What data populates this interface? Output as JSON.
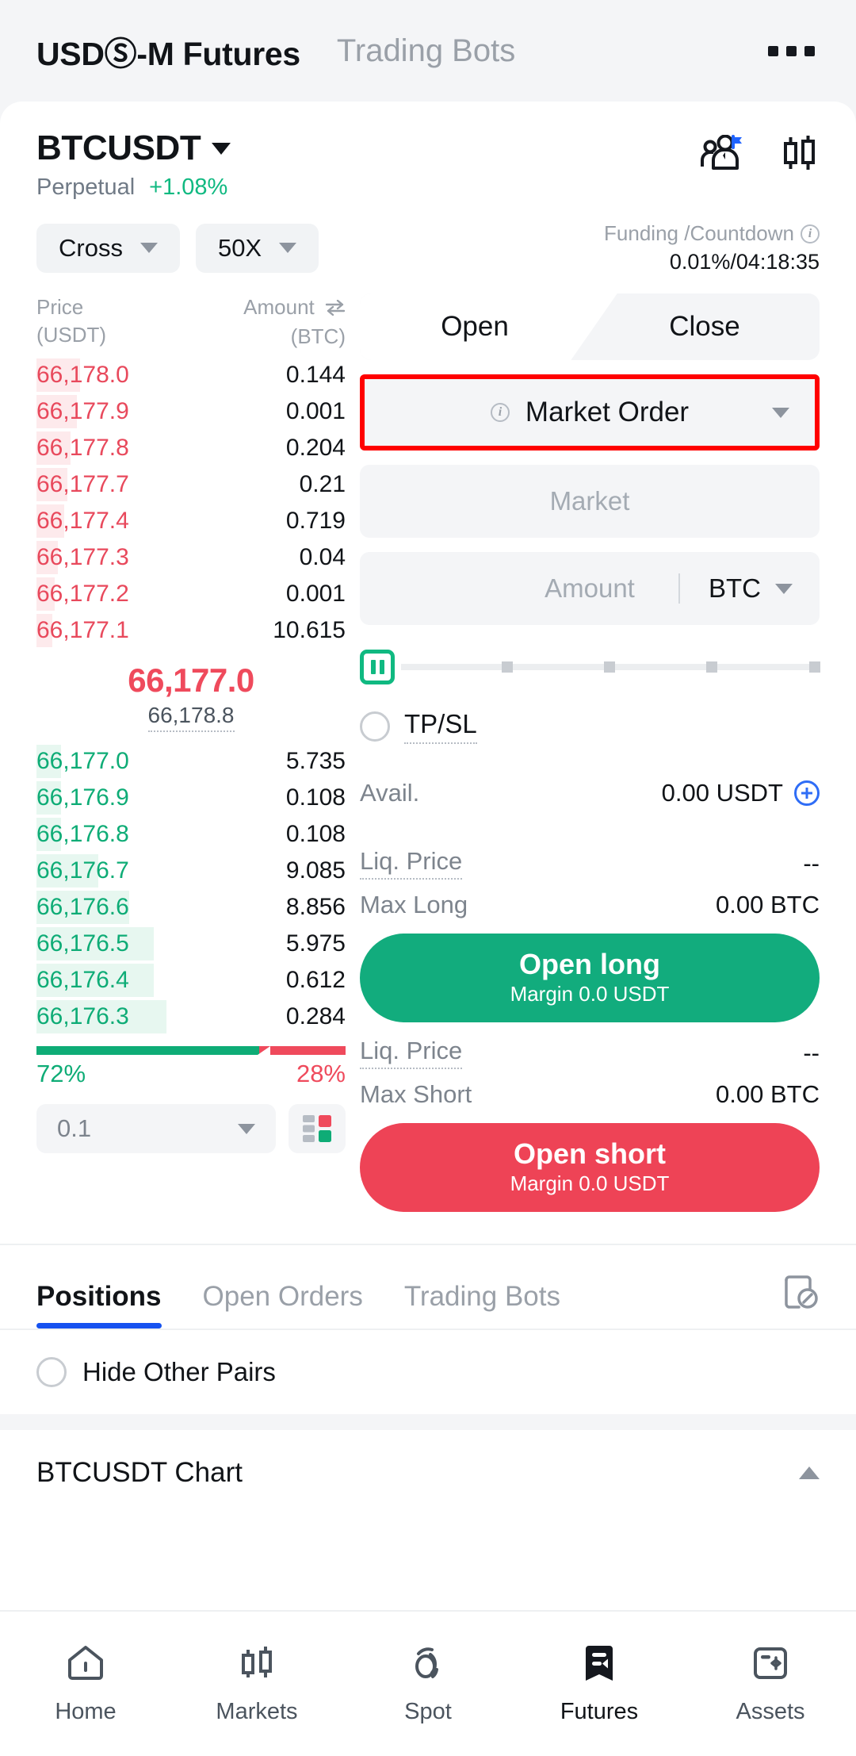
{
  "topbar": {
    "title_prefix": "USD",
    "title_mark": "Ⓢ",
    "title_suffix": "-M Futures",
    "tab_trading_bots": "Trading Bots",
    "more_icon": "more-horizontal-icon"
  },
  "symbol": {
    "name": "BTCUSDT",
    "contract_type": "Perpetual",
    "change_pct": "+1.08%",
    "leaderboard_icon": "copy-trading-icon",
    "chart_icon": "candlestick-chart-icon"
  },
  "controls": {
    "margin_mode": "Cross",
    "leverage": "50X",
    "funding_label": "Funding /Countdown",
    "funding_value": "0.01%/04:18:35"
  },
  "orderbook": {
    "col_price": "Price",
    "col_price_unit": "(USDT)",
    "col_amount": "Amount",
    "col_amount_unit": "(BTC)",
    "asks": [
      {
        "price": "66,178.0",
        "amount": "0.144",
        "depth": 14
      },
      {
        "price": "66,177.9",
        "amount": "0.001",
        "depth": 13
      },
      {
        "price": "66,177.8",
        "amount": "0.204",
        "depth": 11
      },
      {
        "price": "66,177.7",
        "amount": "0.21",
        "depth": 10
      },
      {
        "price": "66,177.4",
        "amount": "0.719",
        "depth": 9
      },
      {
        "price": "66,177.3",
        "amount": "0.04",
        "depth": 7
      },
      {
        "price": "66,177.2",
        "amount": "0.001",
        "depth": 6
      },
      {
        "price": "66,177.1",
        "amount": "10.615",
        "depth": 5
      }
    ],
    "last_price": "66,177.0",
    "mark_price": "66,178.8",
    "bids": [
      {
        "price": "66,177.0",
        "amount": "5.735",
        "depth": 8
      },
      {
        "price": "66,176.9",
        "amount": "0.108",
        "depth": 8
      },
      {
        "price": "66,176.8",
        "amount": "0.108",
        "depth": 8
      },
      {
        "price": "66,176.7",
        "amount": "9.085",
        "depth": 20
      },
      {
        "price": "66,176.6",
        "amount": "8.856",
        "depth": 30
      },
      {
        "price": "66,176.5",
        "amount": "5.975",
        "depth": 38
      },
      {
        "price": "66,176.4",
        "amount": "0.612",
        "depth": 38
      },
      {
        "price": "66,176.3",
        "amount": "0.284",
        "depth": 42
      }
    ],
    "buy_ratio": "72%",
    "sell_ratio": "28%",
    "buy_ratio_value": 72,
    "sell_ratio_value": 28,
    "tick_size": "0.1",
    "layout_toggle_icon": "orderbook-layout-icon"
  },
  "order_form": {
    "tab_open": "Open",
    "tab_close": "Close",
    "order_type": "Market Order",
    "order_type_info_icon": "info-circle-icon",
    "price_placeholder": "Market",
    "amount_placeholder": "Amount",
    "amount_unit": "BTC",
    "tpsl_label": "TP/SL",
    "avail_label": "Avail.",
    "avail_value": "0.00 USDT",
    "add_funds_icon": "plus-circle-icon",
    "long": {
      "liq_label": "Liq. Price",
      "liq_value": "--",
      "max_label": "Max Long",
      "max_value": "0.00 BTC",
      "button_label": "Open long",
      "margin_label": "Margin",
      "margin_value": "0.0 USDT"
    },
    "short": {
      "liq_label": "Liq. Price",
      "liq_value": "--",
      "max_label": "Max Short",
      "max_value": "0.00 BTC",
      "button_label": "Open short",
      "margin_label": "Margin",
      "margin_value": "0.0 USDT"
    }
  },
  "positions_section": {
    "tabs": [
      {
        "label": "Positions",
        "active": true
      },
      {
        "label": "Open Orders",
        "active": false
      },
      {
        "label": "Trading Bots",
        "active": false
      }
    ],
    "history_icon": "order-history-icon",
    "hide_other_pairs": "Hide Other Pairs"
  },
  "chart_section": {
    "label": "BTCUSDT Chart",
    "collapse_icon": "caret-up-icon"
  },
  "bottom_nav": [
    {
      "label": "Home",
      "icon": "home-icon",
      "active": false
    },
    {
      "label": "Markets",
      "icon": "candlestick-icon",
      "active": false
    },
    {
      "label": "Spot",
      "icon": "spot-coins-icon",
      "active": false
    },
    {
      "label": "Futures",
      "icon": "futures-icon",
      "active": true
    },
    {
      "label": "Assets",
      "icon": "assets-wallet-icon",
      "active": false
    }
  ],
  "colors": {
    "up_green": "#0eac76",
    "down_red": "#ef4a5c",
    "accent_blue": "#1652f0",
    "annotation_red": "#ff0000"
  }
}
